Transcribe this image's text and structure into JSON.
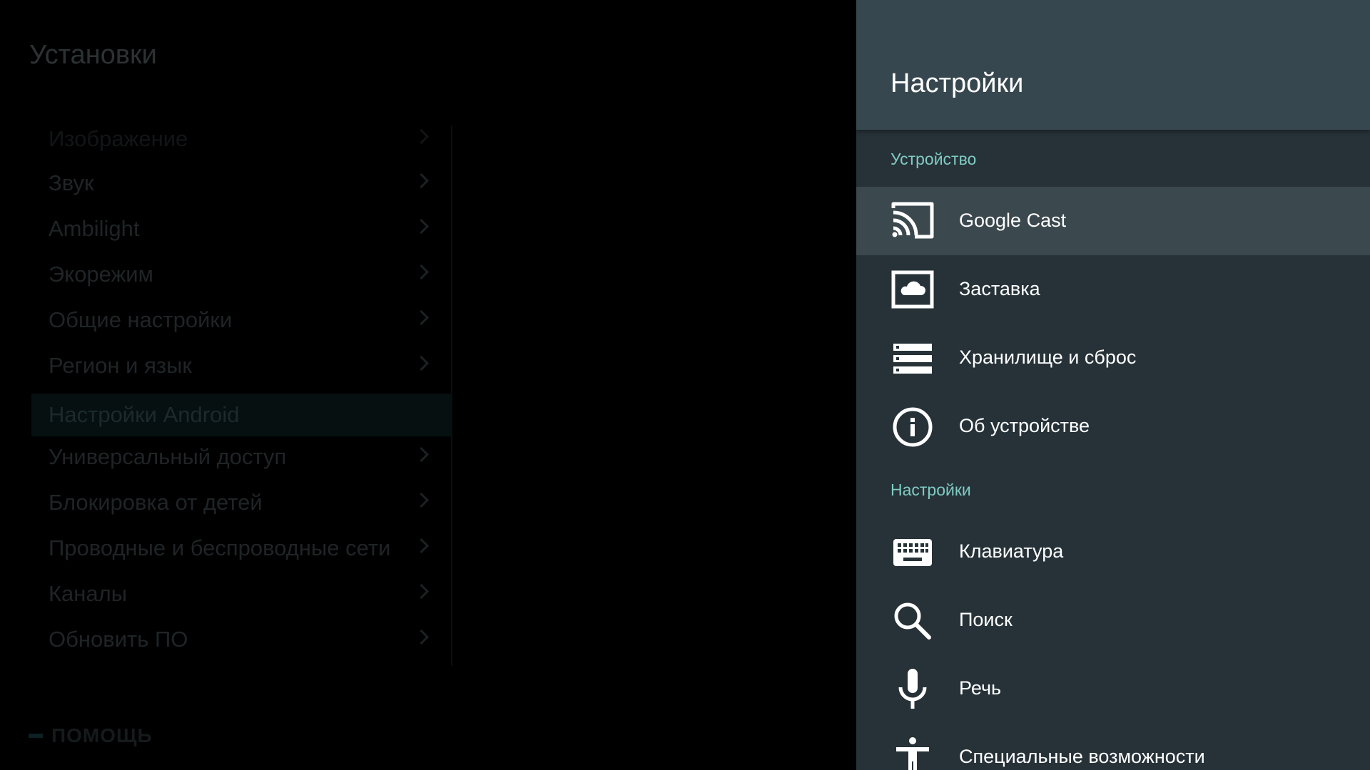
{
  "left": {
    "title": "Установки",
    "items": [
      {
        "label": "Изображение"
      },
      {
        "label": "Звук"
      },
      {
        "label": "Ambilight"
      },
      {
        "label": "Экорежим"
      },
      {
        "label": "Общие настройки"
      },
      {
        "label": "Регион и язык"
      },
      {
        "label": "Настройки Android"
      },
      {
        "label": "Универсальный доступ"
      },
      {
        "label": "Блокировка от детей"
      },
      {
        "label": "Проводные и беспроводные сети"
      },
      {
        "label": "Каналы"
      },
      {
        "label": "Обновить ПО"
      }
    ],
    "help": "ПОМОЩЬ"
  },
  "drawer": {
    "title": "Настройки",
    "section_device": "Устройство",
    "section_settings": "Настройки",
    "items": [
      {
        "label": "Google Cast",
        "icon": "cast-icon"
      },
      {
        "label": "Заставка",
        "icon": "screensaver-icon"
      },
      {
        "label": "Хранилище и сброс",
        "icon": "storage-icon"
      },
      {
        "label": "Об устройстве",
        "icon": "info-icon"
      },
      {
        "label": "Клавиатура",
        "icon": "keyboard-icon"
      },
      {
        "label": "Поиск",
        "icon": "search-icon"
      },
      {
        "label": "Речь",
        "icon": "microphone-icon"
      },
      {
        "label": "Специальные возможности",
        "icon": "accessibility-icon"
      }
    ]
  },
  "colors": {
    "drawer_bg": "#263238",
    "header_bg": "#37474f",
    "focused_row": "#3b484e",
    "section_accent": "#80cbc4"
  }
}
